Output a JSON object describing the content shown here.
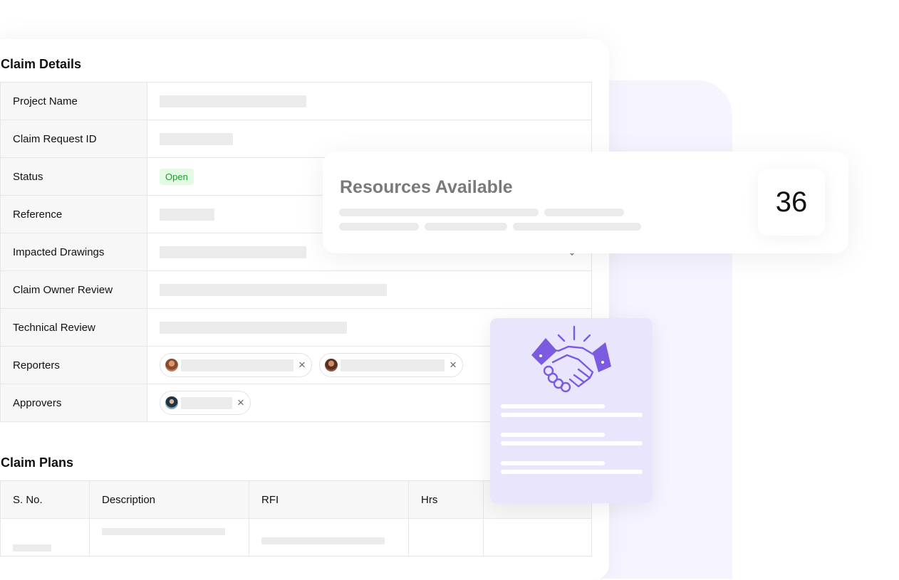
{
  "claim_details": {
    "title": "Claim Details",
    "rows": [
      {
        "label": "Project Name"
      },
      {
        "label": "Claim Request ID"
      },
      {
        "label": "Status",
        "status": "Open"
      },
      {
        "label": "Reference"
      },
      {
        "label": "Impacted Drawings"
      },
      {
        "label": "Claim Owner Review"
      },
      {
        "label": "Technical Review"
      },
      {
        "label": "Reporters"
      },
      {
        "label": "Approvers"
      }
    ],
    "remove_glyph": "×"
  },
  "claim_plans": {
    "title": "Claim Plans",
    "columns": [
      "S. No.",
      "Description",
      "RFI",
      "Hrs"
    ]
  },
  "resources": {
    "title": "Resources Available",
    "count": "36"
  },
  "colors": {
    "accent_purple": "#7b5be0",
    "badge_green": "#1f9b2e",
    "backdrop_lavender": "#f6f4ff"
  },
  "icons": [
    "remove-icon",
    "chevron-down-icon",
    "handshake-icon"
  ]
}
